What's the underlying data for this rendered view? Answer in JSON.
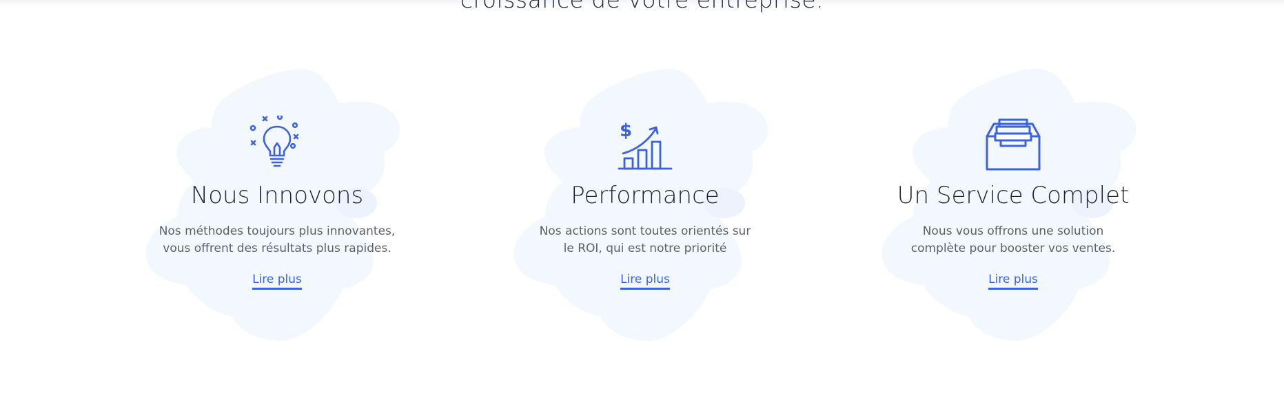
{
  "section": {
    "heading": "croissance de votre entreprise."
  },
  "colors": {
    "accent": "#3a62e0",
    "blob": "#f3f7fe",
    "title": "#1f2435",
    "text": "#5c5f6a"
  },
  "cards": [
    {
      "icon": "lightbulb-icon",
      "title": "Nous Innovons",
      "description": "Nos méthodes toujours plus innovantes,\nvous  offrent des résultats plus rapides.",
      "link": "Lire plus"
    },
    {
      "icon": "growth-chart-icon",
      "title": "Performance",
      "description": "Nos actions sont toutes orientés sur\nle ROI, qui est notre priorité",
      "link": "Lire plus"
    },
    {
      "icon": "inbox-tray-icon",
      "title": "Un Service Complet",
      "description": "Nous vous offrons une solution\ncomplète pour booster vos ventes.",
      "link": "Lire plus"
    }
  ]
}
